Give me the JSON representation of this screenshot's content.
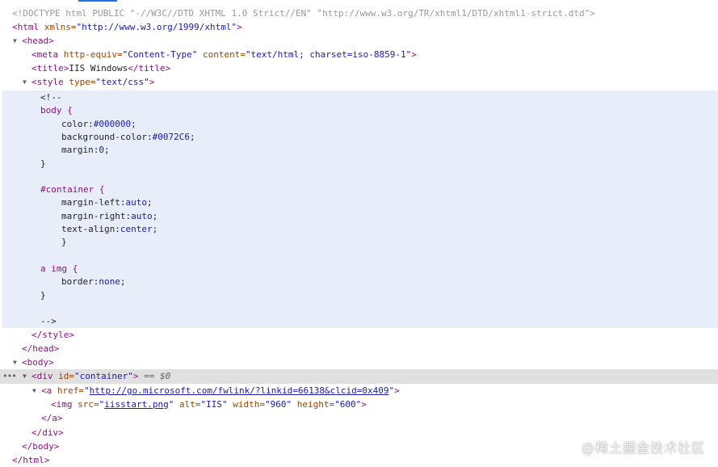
{
  "doctype": "<!DOCTYPE html PUBLIC \"-//W3C//DTD XHTML 1.0 Strict//EN\" \"http://www.w3.org/TR/xhtml1/DTD/xhtml1-strict.dtd\">",
  "html_open": {
    "tag": "<html",
    "attr": " xmlns=",
    "val": "\"http://www.w3.org/1999/xhtml\"",
    "close": ">"
  },
  "head_open": "<head>",
  "meta": {
    "tag": "<meta",
    "a1": " http-equiv=",
    "v1": "\"Content-Type\"",
    "a2": " content=",
    "v2": "\"text/html; charset=iso-8859-1\"",
    "close": ">"
  },
  "title": {
    "open": "<title>",
    "text": "IIS Windows",
    "close": "</title>"
  },
  "style_open": {
    "tag": "<style",
    "attr": " type=",
    "val": "\"text/css\"",
    "close": ">"
  },
  "css": {
    "comment_open": "<!--",
    "body_sel": "body {",
    "color_prop": "color:",
    "color_val": "#000000",
    "bg_prop": "background-color:",
    "bg_val": "#0072C6",
    "margin_prop": "margin:",
    "margin_val": "0",
    "close1": "}",
    "container_sel": "#container {",
    "ml_prop": "margin-left:",
    "ml_val": "auto",
    "mr_prop": "margin-right:",
    "mr_val": "auto",
    "ta_prop": "text-align:",
    "ta_val": "center",
    "close2": "}",
    "a_img_sel": "a img {",
    "border_prop": "border:",
    "border_val": "none",
    "close3": "}",
    "comment_close": "-->",
    "semicolon": ";"
  },
  "style_close": "</style>",
  "head_close": "</head>",
  "body_open": "<body>",
  "div_open": {
    "tag": "<div",
    "attr": " id=",
    "val": "\"container\"",
    "close": ">",
    "eq": " == ",
    "dollar": "$0"
  },
  "a_open": {
    "tag": "<a",
    "attr": " href=",
    "q1": "\"",
    "url": "http://go.microsoft.com/fwlink/?linkid=66138&clcid=0x409",
    "q2": "\"",
    "close": ">"
  },
  "img": {
    "tag": "<img",
    "a1": " src=",
    "q1": "\"",
    "src": "iisstart.png",
    "q2": "\"",
    "a2": " alt=",
    "v2": "\"IIS\"",
    "a3": " width=",
    "v3": "\"960\"",
    "a4": " height=",
    "v4": "\"600\"",
    "close": ">"
  },
  "a_close": "</a>",
  "div_close": "</div>",
  "body_close": "</body>",
  "html_close": "</html>",
  "ellipsis": "•••",
  "watermark": "@稀土掘金技术社区"
}
